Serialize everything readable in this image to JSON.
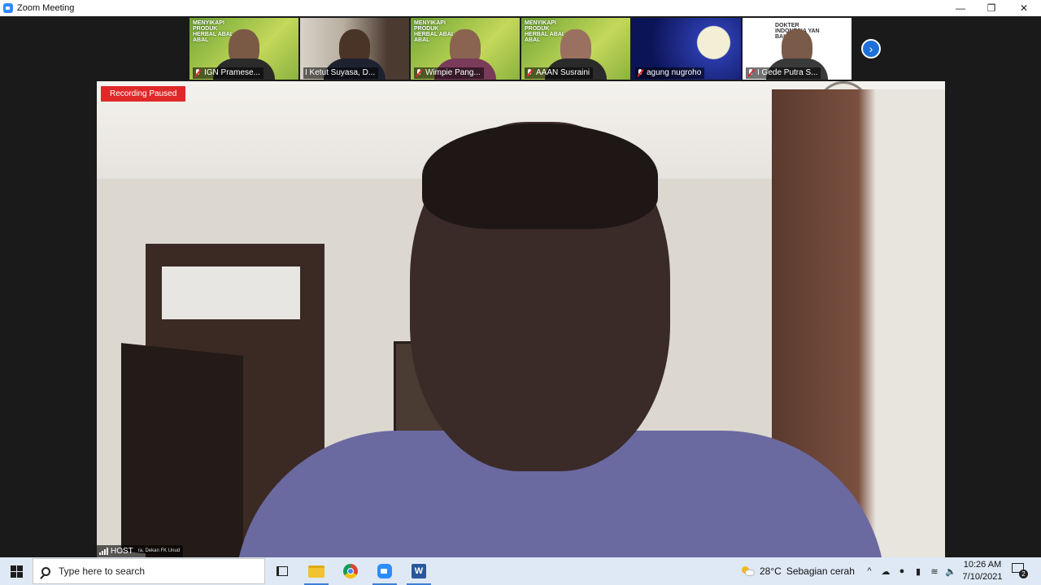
{
  "window": {
    "title": "Zoom Meeting",
    "controls": {
      "minimize": "—",
      "restore": "❐",
      "close": "✕"
    }
  },
  "gallery": {
    "participants": [
      {
        "name": "IGN Pramese...",
        "muted": true,
        "poster": "MENYIKAPI PRODUK HERBAL ABAL-ABAL"
      },
      {
        "name": "I Ketut Suyasa, D...",
        "muted": false,
        "poster": ""
      },
      {
        "name": "Wimpie Pang...",
        "muted": true,
        "poster": "MENYIKAPI PRODUK HERBAL ABAL-ABAL"
      },
      {
        "name": "AAAN Susraini",
        "muted": true,
        "poster": "MENYIKAPI PRODUK HERBAL ABAL-ABAL"
      },
      {
        "name": "agung nugroho",
        "muted": true,
        "poster": ""
      },
      {
        "name": "I Gede Putra S...",
        "muted": true,
        "poster": "DOKTER INDONESIA YAN BALI"
      }
    ],
    "next_icon": "chevron-right-icon"
  },
  "main_video": {
    "recording_label": "Recording Paused",
    "host_label": "HOST",
    "host_sub": "ra, Dekan FK Unud"
  },
  "taskbar": {
    "search_placeholder": "Type here to search",
    "weather": {
      "temp": "28°C",
      "condition": "Sebagian cerah"
    },
    "tray": {
      "chevron": "^",
      "network": "☁",
      "mic": "●",
      "battery": "▮",
      "wifi": "≋",
      "volume": "🔈"
    },
    "clock": {
      "time": "10:26 AM",
      "date": "7/10/2021"
    },
    "notifications": "2"
  },
  "colors": {
    "recording": "#e02828",
    "zoom_blue": "#2d8cff",
    "taskbar_bg": "#dfe9f5"
  }
}
